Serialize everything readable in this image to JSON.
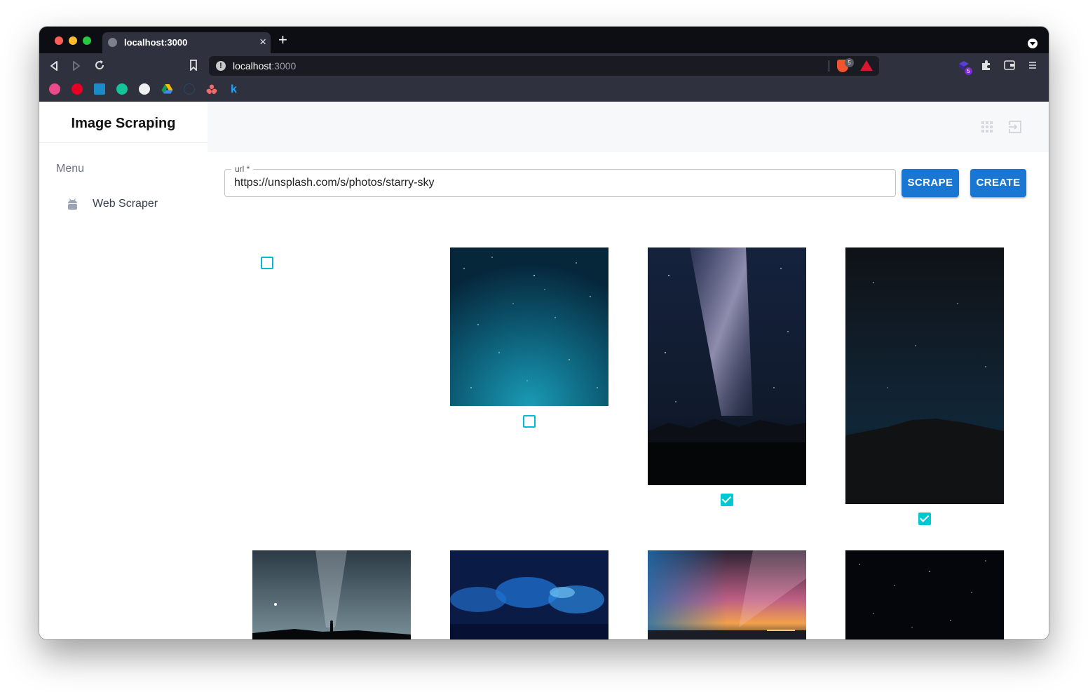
{
  "browser": {
    "tab_title": "localhost:3000",
    "address_host": "localhost",
    "address_port": ":3000",
    "brave_badge_count": "5",
    "extension_badge_count": "5",
    "bookmarks": [
      "dribbble-icon",
      "pinterest-icon",
      "analytics-icon",
      "grammarly-icon",
      "github-icon",
      "google-drive-icon",
      "react-icon",
      "asana-icon",
      "k-icon"
    ],
    "bookmark_k_label": "k"
  },
  "sidebar": {
    "brand": "Image Scraping",
    "menu_heading": "Menu",
    "items": [
      {
        "label": "Web Scraper",
        "icon": "android-icon"
      }
    ]
  },
  "form": {
    "url_label": "url *",
    "url_value": "https://unsplash.com/s/photos/starry-sky",
    "scrape_label": "SCRAPE",
    "create_label": "CREATE"
  },
  "gallery": {
    "images": [
      {
        "name": "blank-image",
        "checked": false
      },
      {
        "name": "teal-starfield-image",
        "checked": false
      },
      {
        "name": "milky-way-mountains-image",
        "checked": true
      },
      {
        "name": "dark-hill-night-sky-image",
        "checked": true
      },
      {
        "name": "person-under-milky-way-image",
        "checked": false
      },
      {
        "name": "blue-nebula-image",
        "checked": false
      },
      {
        "name": "sunset-milky-way-image",
        "checked": false
      },
      {
        "name": "dark-starfield-image",
        "checked": false
      }
    ]
  },
  "colors": {
    "primary": "#1976d2",
    "checkbox": "#00bcd4"
  }
}
